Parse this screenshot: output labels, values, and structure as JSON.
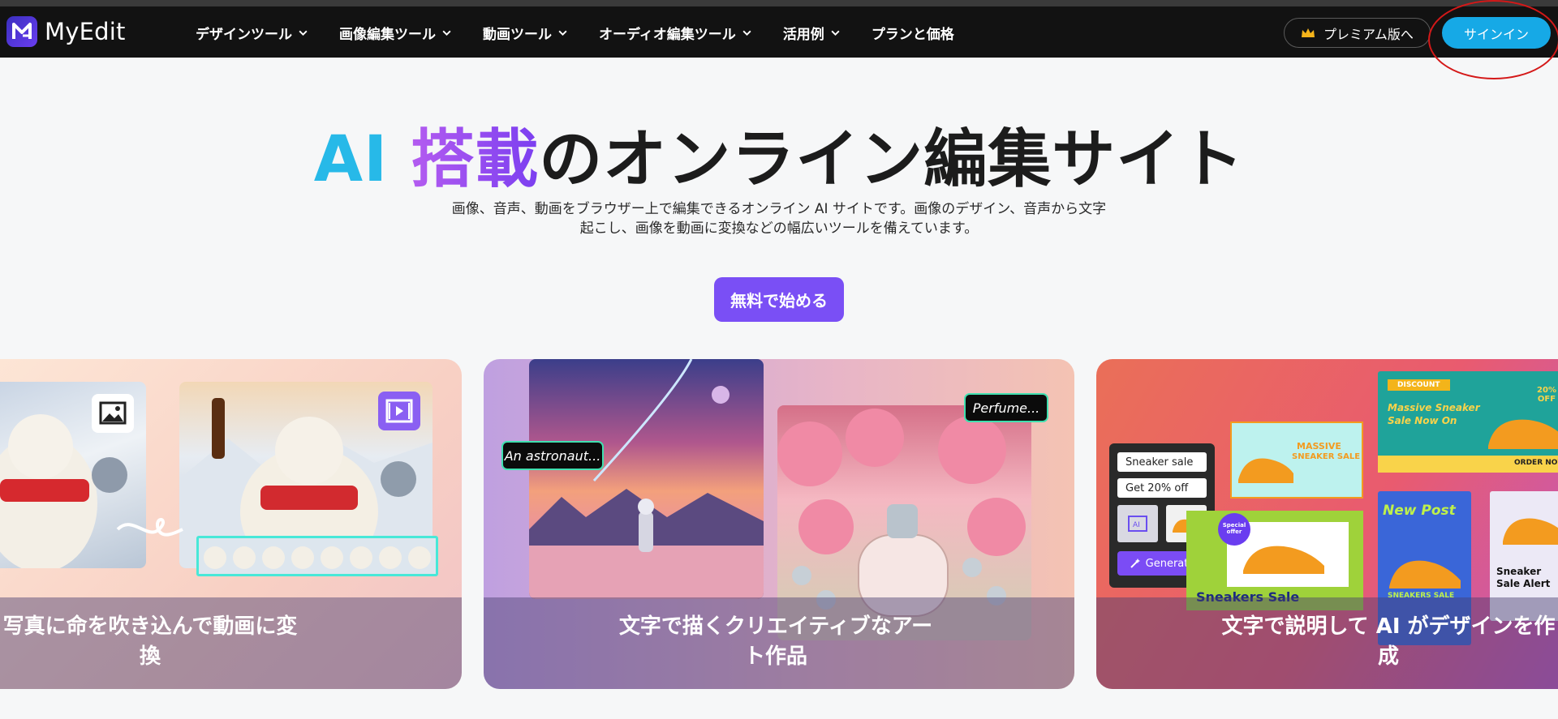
{
  "brand": {
    "name": "MyEdit"
  },
  "nav": {
    "items": [
      {
        "label": "デザインツール"
      },
      {
        "label": "画像編集ツール"
      },
      {
        "label": "動画ツール"
      },
      {
        "label": "オーディオ編集ツール"
      },
      {
        "label": "活用例"
      },
      {
        "label": "プランと価格"
      }
    ],
    "premium_label": "プレミアム版へ",
    "signin_label": "サインイン"
  },
  "hero": {
    "title_ai": "AI ",
    "title_highlight": "搭載",
    "title_rest": "のオンライン編集サイト",
    "subtitle_line1": "画像、音声、動画をブラウザー上で編集できるオンライン AI サイトです。画像のデザイン、音声から文字",
    "subtitle_line2": "起こし、画像を動画に変換などの幅広いツールを備えています。",
    "cta_label": "無料で始める"
  },
  "cards": [
    {
      "label": "写真に命を吹き込んで動画に変換"
    },
    {
      "label": "文字で描くクリエイティブなアート作品",
      "chip_left": "An astronaut...",
      "chip_right": "Perfume..."
    },
    {
      "label": "文字で説明して AI がデザインを作成",
      "input1": "Sneaker sale",
      "input2": "Get 20% off",
      "generate_label": "Generate",
      "caption": "Sneakers Sale",
      "promo1_line1": "MASSIVE",
      "promo1_line2": "SNEAKER SALE",
      "promo2_tag": "DISCOUNT",
      "promo2_line1": "Massive Sneaker",
      "promo2_line2": "Sale Now On",
      "promo2_pct": "20% OFF",
      "promo2_cta": "ORDER NOW",
      "promo3_title": "New Post",
      "promo3_caption": "SNEAKERS SALE",
      "promo4_line1": "Sneaker",
      "promo4_line2": "Sale Alert",
      "special": "Special offer"
    }
  ],
  "colors": {
    "accent": "#7a4ff5",
    "signin": "#16a9e6",
    "annotation": "#d41818"
  }
}
